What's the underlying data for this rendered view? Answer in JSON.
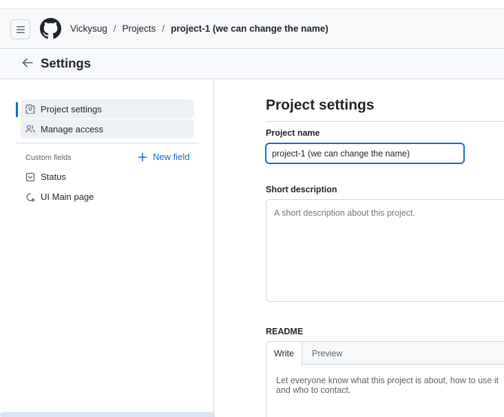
{
  "header": {
    "breadcrumbs": [
      {
        "label": "Vickysug"
      },
      {
        "label": "Projects"
      },
      {
        "label": "project-1 (we can change the name)"
      }
    ],
    "separator": "/"
  },
  "subheader": {
    "title": "Settings"
  },
  "sidebar": {
    "items": [
      {
        "label": "Project settings",
        "icon": "gear-icon",
        "active": true
      },
      {
        "label": "Manage access",
        "icon": "people-icon",
        "active": false
      }
    ],
    "custom_fields_label": "Custom fields",
    "new_field_label": "New field",
    "fields": [
      {
        "label": "Status",
        "icon": "single-select-icon"
      },
      {
        "label": "UI Main page",
        "icon": "iteration-icon"
      }
    ]
  },
  "main": {
    "title": "Project settings",
    "project_name_label": "Project name",
    "project_name_value": "project-1 (we can change the name)",
    "short_description_label": "Short description",
    "short_description_placeholder": "A short description about this project.",
    "readme_label": "README",
    "readme_tabs": [
      {
        "label": "Write",
        "selected": true
      },
      {
        "label": "Preview",
        "selected": false
      }
    ],
    "readme_placeholder": "Let everyone know what this project is about, how to use it and who to contact."
  },
  "colors": {
    "accent": "#0969da",
    "header_bg": "#f6f8fa",
    "border": "#d0d7de",
    "text": "#1f2328",
    "muted": "#59636e"
  }
}
